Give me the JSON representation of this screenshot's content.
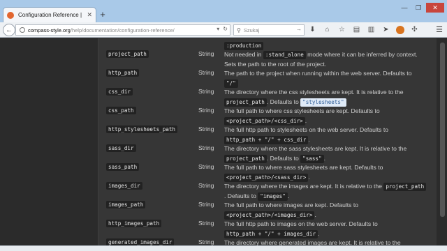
{
  "tab": {
    "title": "Configuration Reference | ...",
    "close": "✕",
    "new_tab": "+"
  },
  "window_controls": {
    "minimize": "—",
    "maximize": "❐",
    "close": "✕"
  },
  "nav": {
    "back": "←",
    "url_host": "compass-style.org",
    "url_path": "/help/documentation/configuration-reference/",
    "url_dropdown": "▾",
    "reload": "↻",
    "search_placeholder": "Szukaj",
    "search_go": "→"
  },
  "toolbar_icons": [
    "download-icon",
    "home-icon",
    "bookmark-star-icon",
    "clipboard-icon",
    "reader-icon",
    "send-icon",
    "firefox-icon",
    "extensions-icon",
    "menu-icon"
  ],
  "content": {
    "top_continuation": ":production",
    "rows": [
      {
        "prop": "project_path",
        "type": "String",
        "desc": [
          {
            "t": "Not needed in "
          },
          {
            "c": ":stand_alone"
          },
          {
            "t": " mode where it can be inferred by context. Sets the path to the root of the project."
          }
        ]
      },
      {
        "prop": "http_path",
        "type": "String",
        "desc": [
          {
            "t": "The path to the project when running within the web server. Defaults to "
          },
          {
            "c": "\"/\""
          }
        ]
      },
      {
        "prop": "css_dir",
        "type": "String",
        "desc": [
          {
            "t": "The directory where the css stylesheets are kept. It is relative to the "
          },
          {
            "c": "project_path"
          },
          {
            "t": ". Defaults to "
          },
          {
            "c": "\"stylesheets\"",
            "hl": true
          }
        ]
      },
      {
        "prop": "css_path",
        "type": "String",
        "desc": [
          {
            "t": "The full path to where css stylesheets are kept. Defaults to "
          },
          {
            "c": "<project_path>/<css_dir>"
          },
          {
            "t": "."
          }
        ]
      },
      {
        "prop": "http_stylesheets_path",
        "type": "String",
        "desc": [
          {
            "t": "The full http path to stylesheets on the web server. Defaults to "
          },
          {
            "c": "http_path + \"/\" + css_dir"
          },
          {
            "t": "."
          }
        ]
      },
      {
        "prop": "sass_dir",
        "type": "String",
        "desc": [
          {
            "t": "The directory where the sass stylesheets are kept. It is relative to the "
          },
          {
            "c": "project_path"
          },
          {
            "t": ". Defaults to "
          },
          {
            "c": "\"sass\""
          },
          {
            "t": "."
          }
        ]
      },
      {
        "prop": "sass_path",
        "type": "String",
        "desc": [
          {
            "t": "The full path to where sass stylesheets are kept. Defaults to "
          },
          {
            "c": "<project_path>/<sass_dir>"
          },
          {
            "t": "."
          }
        ]
      },
      {
        "prop": "images_dir",
        "type": "String",
        "desc": [
          {
            "t": "The directory where the images are kept. It is relative to the "
          },
          {
            "c": "project_path"
          },
          {
            "t": ". Defaults to "
          },
          {
            "c": "\"images\""
          },
          {
            "t": "."
          }
        ]
      },
      {
        "prop": "images_path",
        "type": "String",
        "desc": [
          {
            "t": "The full path to where images are kept. Defaults to "
          },
          {
            "c": "<project_path>/<images_dir>"
          },
          {
            "t": "."
          }
        ]
      },
      {
        "prop": "http_images_path",
        "type": "String",
        "desc": [
          {
            "t": "The full http path to images on the web server. Defaults to "
          },
          {
            "c": "http_path + \"/\" + images_dir"
          },
          {
            "t": "."
          }
        ]
      },
      {
        "prop": "generated_images_dir",
        "type": "String",
        "desc": [
          {
            "t": "The directory where generated images are kept. It is relative to the"
          }
        ]
      }
    ]
  },
  "status": {
    "left": "",
    "right": ""
  }
}
